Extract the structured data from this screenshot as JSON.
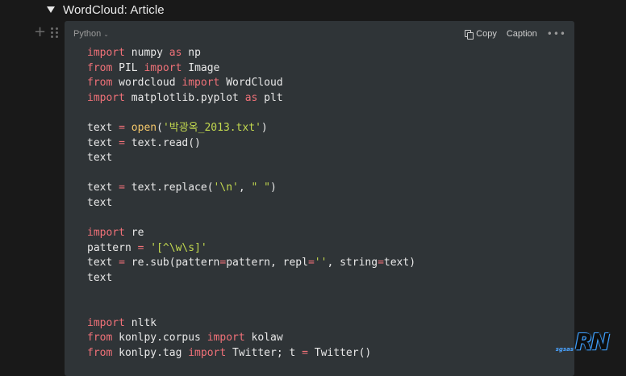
{
  "toggle": {
    "title": "WordCloud: Article"
  },
  "code_block": {
    "language": "Python",
    "copy_label": "Copy",
    "caption_label": "Caption",
    "more_label": "•••",
    "lines": [
      [
        [
          "kw",
          "import"
        ],
        [
          "t",
          " numpy "
        ],
        [
          "kw",
          "as"
        ],
        [
          "t",
          " np"
        ]
      ],
      [
        [
          "kw",
          "from"
        ],
        [
          "t",
          " PIL "
        ],
        [
          "kw",
          "import"
        ],
        [
          "t",
          " Image"
        ]
      ],
      [
        [
          "kw",
          "from"
        ],
        [
          "t",
          " wordcloud "
        ],
        [
          "kw",
          "import"
        ],
        [
          "t",
          " WordCloud"
        ]
      ],
      [
        [
          "kw",
          "import"
        ],
        [
          "t",
          " matplotlib.pyplot "
        ],
        [
          "kw",
          "as"
        ],
        [
          "t",
          " plt"
        ]
      ],
      [],
      [
        [
          "t",
          "text "
        ],
        [
          "op",
          "="
        ],
        [
          "t",
          " "
        ],
        [
          "fn",
          "open"
        ],
        [
          "t",
          "("
        ],
        [
          "str",
          "'박광옥_2013.txt'"
        ],
        [
          "t",
          ")"
        ]
      ],
      [
        [
          "t",
          "text "
        ],
        [
          "op",
          "="
        ],
        [
          "t",
          " text.read()"
        ]
      ],
      [
        [
          "t",
          "text"
        ]
      ],
      [],
      [
        [
          "t",
          "text "
        ],
        [
          "op",
          "="
        ],
        [
          "t",
          " text.replace("
        ],
        [
          "str",
          "'\\n'"
        ],
        [
          "t",
          ", "
        ],
        [
          "str",
          "\" \""
        ],
        [
          "t",
          ")"
        ]
      ],
      [
        [
          "t",
          "text"
        ]
      ],
      [],
      [
        [
          "kw",
          "import"
        ],
        [
          "t",
          " re"
        ]
      ],
      [
        [
          "t",
          "pattern "
        ],
        [
          "op",
          "="
        ],
        [
          "t",
          " "
        ],
        [
          "str",
          "'[^\\w\\s]'"
        ]
      ],
      [
        [
          "t",
          "text "
        ],
        [
          "op",
          "="
        ],
        [
          "t",
          " re.sub(pattern"
        ],
        [
          "op",
          "="
        ],
        [
          "t",
          "pattern, repl"
        ],
        [
          "op",
          "="
        ],
        [
          "str",
          "''"
        ],
        [
          "t",
          ", string"
        ],
        [
          "op",
          "="
        ],
        [
          "t",
          "text)"
        ]
      ],
      [
        [
          "t",
          "text"
        ]
      ],
      [],
      [],
      [
        [
          "kw",
          "import"
        ],
        [
          "t",
          " nltk"
        ]
      ],
      [
        [
          "kw",
          "from"
        ],
        [
          "t",
          " konlpy.corpus "
        ],
        [
          "kw",
          "import"
        ],
        [
          "t",
          " kolaw"
        ]
      ],
      [
        [
          "kw",
          "from"
        ],
        [
          "t",
          " konlpy.tag "
        ],
        [
          "kw",
          "import"
        ],
        [
          "t",
          " Twitter; t "
        ],
        [
          "op",
          "="
        ],
        [
          "t",
          " Twitter()"
        ]
      ]
    ]
  },
  "watermark": {
    "small": "sgsas",
    "big": "RN"
  },
  "icons": {
    "toggle": "triangle-down-icon",
    "add": "plus-icon",
    "drag": "drag-handle-icon",
    "copy": "copy-icon",
    "more": "more-icon"
  },
  "colors": {
    "background": "#191919",
    "code_background": "#2f3437",
    "keyword": "#f07178",
    "string": "#c3d94f",
    "function": "#f4c76a"
  }
}
